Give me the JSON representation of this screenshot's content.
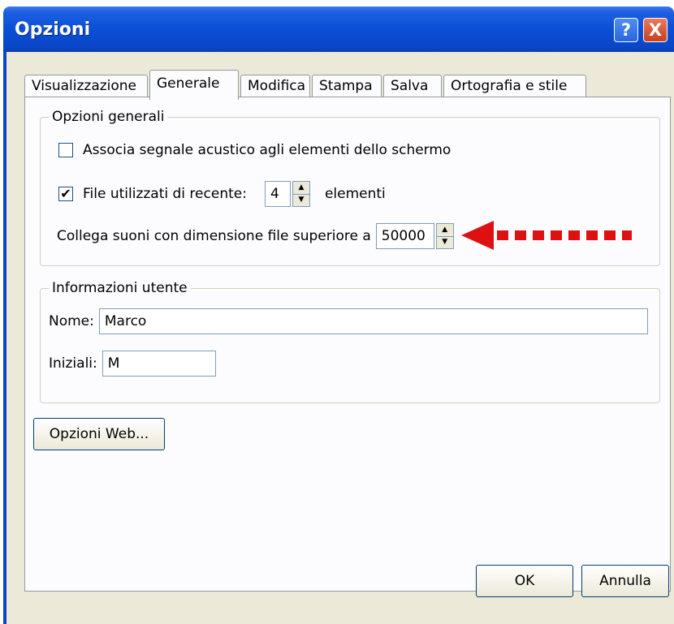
{
  "window": {
    "title": "Opzioni",
    "help_label": "?",
    "close_label": "X"
  },
  "tabs": [
    {
      "label": "Visualizzazione",
      "active": false
    },
    {
      "label": "Generale",
      "active": true
    },
    {
      "label": "Modifica",
      "active": false
    },
    {
      "label": "Stampa",
      "active": false
    },
    {
      "label": "Salva",
      "active": false
    },
    {
      "label": "Ortografia e stile",
      "active": false
    }
  ],
  "general_options": {
    "legend": "Opzioni generali",
    "beep_checkbox": {
      "label": "Associa segnale acustico agli elementi dello schermo",
      "checked": false
    },
    "recent_files": {
      "label": "File utilizzati di recente:",
      "checked": true,
      "check_mark": "✔",
      "value": "4",
      "suffix": "elementi"
    },
    "sound_size": {
      "label": "Collega suoni con dimensione file superiore a",
      "value": "50000"
    }
  },
  "user_info": {
    "legend": "Informazioni utente",
    "name_label": "Nome:",
    "name_value": "Marco",
    "initials_label": "Iniziali:",
    "initials_value": "M"
  },
  "buttons": {
    "web_options": "Opzioni Web...",
    "ok": "OK",
    "cancel": "Annulla"
  },
  "spinner_glyphs": {
    "up": "▲",
    "down": "▼"
  },
  "colors": {
    "titlebar": "#0a46c8",
    "dialog_bg": "#ece9d8",
    "annotation_arrow": "#dd1111"
  },
  "icons": {
    "annotation": "red-dotted-arrow-icon"
  }
}
